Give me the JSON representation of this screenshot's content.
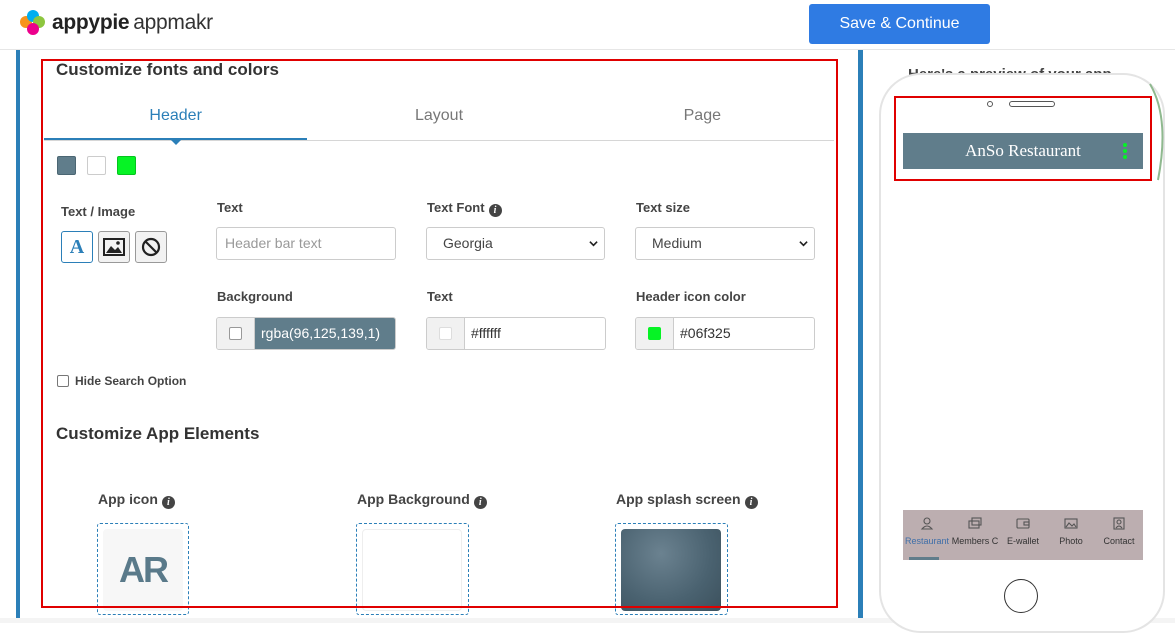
{
  "brand": {
    "name": "appypie",
    "product": "appmakr"
  },
  "toolbar": {
    "save_label": "Save & Continue"
  },
  "fonts_section": {
    "title": "Customize fonts and colors",
    "tabs": [
      {
        "label": "Header",
        "active": true
      },
      {
        "label": "Layout",
        "active": false
      },
      {
        "label": "Page",
        "active": false
      }
    ],
    "swatches": [
      "#607d8b",
      "#ffffff",
      "#06f325"
    ],
    "text_image_label": "Text / Image",
    "text_label": "Text",
    "text_placeholder": "Header bar text",
    "font_label": "Text Font",
    "font_value": "Georgia",
    "size_label": "Text size",
    "size_value": "Medium",
    "background_label": "Background",
    "background_value": "rgba(96,125,139,1)",
    "text_color_label": "Text",
    "text_color_value": "#ffffff",
    "icon_color_label": "Header icon color",
    "icon_color_value": "#06f325",
    "hide_search_label": "Hide Search Option"
  },
  "elements_section": {
    "title": "Customize App Elements",
    "app_icon_label": "App icon",
    "app_icon_text": "AR",
    "app_background_label": "App Background",
    "splash_label": "App splash screen"
  },
  "preview": {
    "title": "Here's a preview of your app",
    "header_title": "AnSo Restaurant",
    "header_bg": "#607d8b",
    "tabs": [
      {
        "label": "Restaurant",
        "icon": "person-icon"
      },
      {
        "label": "Members C",
        "icon": "cards-icon"
      },
      {
        "label": "E-wallet",
        "icon": "wallet-icon"
      },
      {
        "label": "Photo",
        "icon": "photo-icon"
      },
      {
        "label": "Contact",
        "icon": "contact-icon"
      }
    ]
  }
}
